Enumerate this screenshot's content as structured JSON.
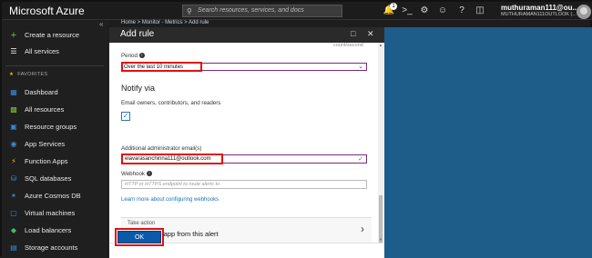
{
  "topbar": {
    "brand": "Microsoft Azure",
    "search_placeholder": "Search resources, services, and docs",
    "notification_count": "1",
    "account_name": "muthuraman111@ou...",
    "account_sub": "MUTHURAMAN111OUTLOOK (..."
  },
  "sidebar": {
    "create": "Create a resource",
    "all_services": "All services",
    "favorites_label": "FAVORITES",
    "items": [
      {
        "label": "Dashboard",
        "icon": "dashboard-icon",
        "color": "#3b8ad6"
      },
      {
        "label": "All resources",
        "icon": "grid-icon",
        "color": "#7cbf3a"
      },
      {
        "label": "Resource groups",
        "icon": "cube-icon",
        "color": "#3b8ad6"
      },
      {
        "label": "App Services",
        "icon": "globe-icon",
        "color": "#3b8ad6"
      },
      {
        "label": "Function Apps",
        "icon": "bolt-icon",
        "color": "#f0c000"
      },
      {
        "label": "SQL databases",
        "icon": "database-icon",
        "color": "#3b8ad6"
      },
      {
        "label": "Azure Cosmos DB",
        "icon": "cosmos-icon",
        "color": "#3b8ad6"
      },
      {
        "label": "Virtual machines",
        "icon": "monitor-icon",
        "color": "#3b8ad6"
      },
      {
        "label": "Load balancers",
        "icon": "balancer-icon",
        "color": "#3bbf6a"
      },
      {
        "label": "Storage accounts",
        "icon": "storage-icon",
        "color": "#3b8ad6"
      }
    ]
  },
  "breadcrumb": "Home > Monitor - Metrics > Add rule",
  "blade": {
    "title": "Add rule",
    "count_label": "count/second",
    "period_label": "Period",
    "period_value": "Over the last 10 minutes",
    "notify_head": "Notify via",
    "email_owners_label": "Email owners, contributors, and readers",
    "additional_email_label": "Additional administrator email(s)",
    "additional_email_value": "elavarasanchinna111@outlook.com",
    "webhook_label": "Webhook",
    "webhook_placeholder": "HTTP or HTTPS endpoint to route alerts to",
    "webhook_link": "Learn more about configuring webhooks",
    "take_action_label": "Take action",
    "take_action_title": "Run a logic app from this alert",
    "ok_label": "OK"
  },
  "colors": {
    "highlight": "#e01010",
    "azure_blue": "#0a5aa8",
    "portal_bg": "#1e5c8a"
  }
}
